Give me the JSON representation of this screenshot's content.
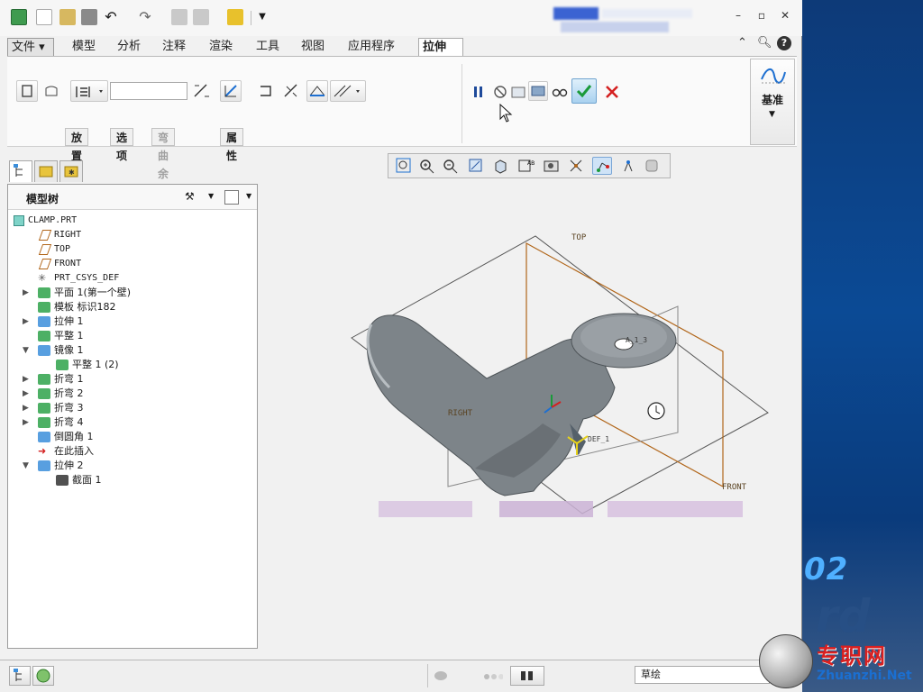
{
  "menu_tabs": {
    "file": "文件",
    "model": "模型",
    "analysis": "分析",
    "annotate": "注释",
    "render": "渲染",
    "tools": "工具",
    "view": "视图",
    "apps": "应用程序",
    "extrude": "拉伸"
  },
  "ribbon": {
    "depth_value": "",
    "subtabs": {
      "placement": "放置",
      "options": "选项",
      "bend_allowance": "弯曲余量",
      "properties": "属性"
    },
    "datum_label": "基准"
  },
  "model_tree": {
    "title": "模型树",
    "root": "CLAMP.PRT",
    "items": [
      {
        "label": "RIGHT",
        "icon": "datum-plane-icon"
      },
      {
        "label": "TOP",
        "icon": "datum-plane-icon"
      },
      {
        "label": "FRONT",
        "icon": "datum-plane-icon"
      },
      {
        "label": "PRT_CSYS_DEF",
        "icon": "csys-icon"
      },
      {
        "label": "平面 1(第一个壁)",
        "icon": "planar-wall-icon"
      },
      {
        "label": "模板 标识182",
        "icon": "template-icon"
      },
      {
        "label": "拉伸 1",
        "icon": "extrude-icon"
      },
      {
        "label": "平整 1",
        "icon": "flat-icon"
      },
      {
        "label": "镜像 1",
        "icon": "mirror-icon"
      },
      {
        "label": "平整 1 (2)",
        "icon": "flat-icon"
      },
      {
        "label": "折弯 1",
        "icon": "bend-icon"
      },
      {
        "label": "折弯 2",
        "icon": "bend-icon"
      },
      {
        "label": "折弯 3",
        "icon": "bend-icon"
      },
      {
        "label": "折弯 4",
        "icon": "bend-icon"
      },
      {
        "label": "倒圆角 1",
        "icon": "round-icon"
      },
      {
        "label": "在此插入",
        "icon": "insert-arrow-icon"
      },
      {
        "label": "拉伸 2",
        "icon": "extrude-icon"
      },
      {
        "label": "截面 1",
        "icon": "sketch-icon"
      }
    ]
  },
  "viewport": {
    "plane_top": "TOP",
    "plane_right": "RIGHT",
    "plane_front": "FRONT",
    "axis_label": "A_1_3",
    "csys_label": "DEF_1"
  },
  "status": {
    "field": "草绘"
  },
  "watermark": {
    "brand_cn": "专职网",
    "brand_en": "Zhuanzhi.Net",
    "bg_number": "02",
    "bg_text": "rd"
  },
  "colors": {
    "accent": "#1d6fd1",
    "ok": "#1a9a3a",
    "cancel": "#d42020",
    "datum": "#b1661a"
  }
}
